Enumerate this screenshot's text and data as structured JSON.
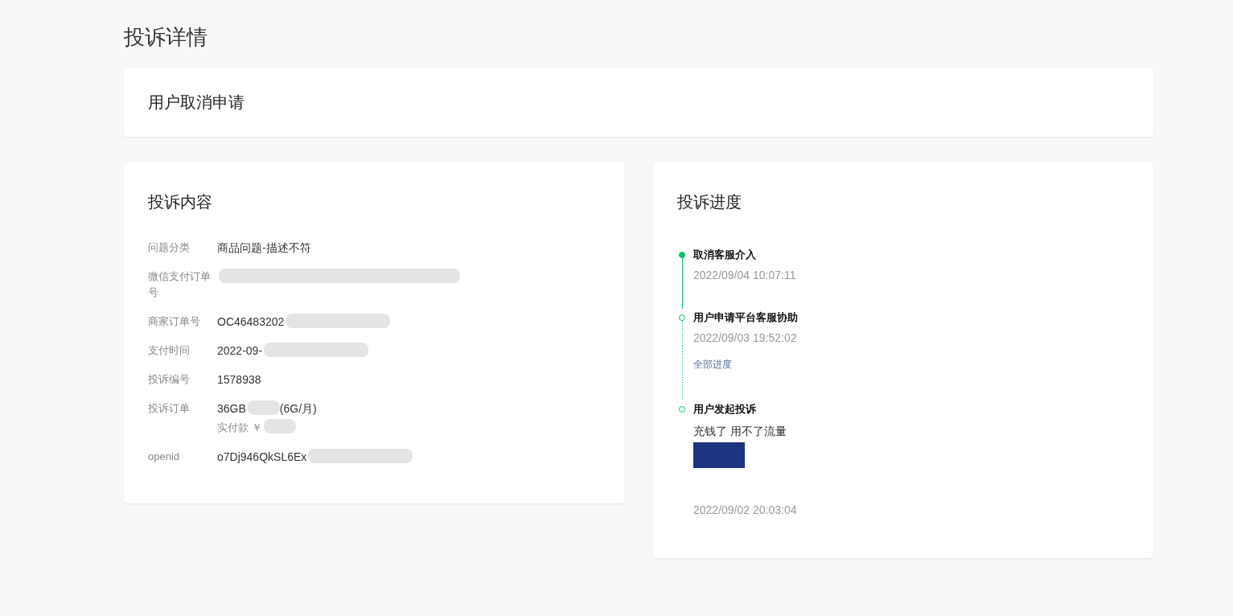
{
  "page_title": "投诉详情",
  "status_card": {
    "title": "用户取消申请"
  },
  "content_card": {
    "title": "投诉内容",
    "fields": [
      {
        "label": "问题分类",
        "value": "商品问题-描述不符",
        "redacted": false
      },
      {
        "label": "微信支付订单号",
        "redacted": true
      },
      {
        "label": "商家订单号",
        "value": "OC46483202",
        "redacted": true
      },
      {
        "label": "支付时间",
        "value": "2022-09-",
        "redacted": true
      },
      {
        "label": "投诉编号",
        "value": "1578938",
        "redacted": false
      },
      {
        "label": "投诉订单",
        "value": "36GB",
        "value_suffix": "(6G/月)",
        "sub_value": "实付款 ￥",
        "redacted": true
      },
      {
        "label": "openid",
        "value": "o7Dj946QkSL6Ex",
        "redacted": true
      }
    ]
  },
  "progress_card": {
    "title": "投诉进度",
    "items": [
      {
        "kind": "event",
        "title": "取消客服介入",
        "time": "2022/09/04 10:07:11",
        "current": true,
        "line_dotted": false
      },
      {
        "kind": "event",
        "title": "用户申请平台客服协助",
        "time": "2022/09/03 19:52:02",
        "current": false,
        "line_dotted": true
      },
      {
        "kind": "link",
        "text": "全部进度"
      },
      {
        "kind": "event",
        "title": "用户发起投诉",
        "note": "充钱了 用不了流量",
        "photo": true,
        "time": "2022/09/02 20:03:04",
        "current": false
      }
    ]
  }
}
